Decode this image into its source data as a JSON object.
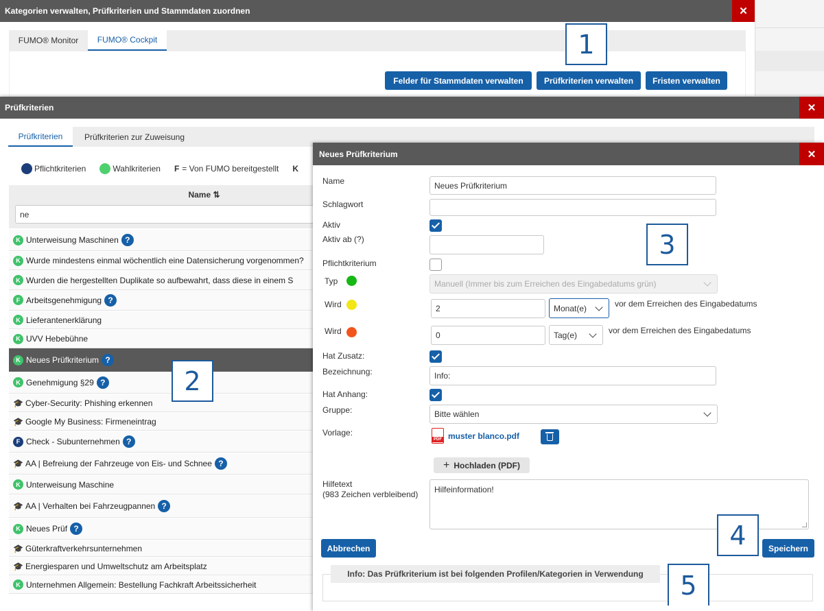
{
  "colors": {
    "primary": "#1660a8",
    "titlebar": "#595959",
    "close": "#c00000",
    "green": "#16b816",
    "yellow": "#f2e615",
    "orange": "#f2551b"
  },
  "win1": {
    "title": "Kategorien verwalten, Prüfkriterien und Stammdaten zuordnen",
    "tabs": [
      "FUMO® Monitor",
      "FUMO® Cockpit"
    ],
    "buttons": [
      "Felder für Stammdaten verwalten",
      "Prüfkriterien verwalten",
      "Fristen verwalten"
    ]
  },
  "win2": {
    "title": "Prüfkriterien",
    "tabs": [
      "Prüfkriterien",
      "Prüfkriterien zur Zuweisung"
    ],
    "legend": {
      "mandatory": "Pflichtkriterien",
      "optional": "Wahlkriterien",
      "f_key": "F",
      "f_text": "= Von FUMO bereitgestellt",
      "k_key": "K"
    },
    "column_header": "Name ⇅",
    "filter_value": "ne",
    "rows": [
      {
        "badge": "K",
        "icon": "k-badge",
        "label": "Unterweisung Maschinen",
        "help": true
      },
      {
        "badge": "K",
        "icon": "k-badge",
        "label": "Wurde mindestens einmal wöchentlich eine Datensicherung vorgenommen?",
        "help": false
      },
      {
        "badge": "K",
        "icon": "k-badge",
        "label": "Wurden die hergestellten Duplikate so aufbewahrt, dass diese in einem S",
        "help": false
      },
      {
        "badge": "F",
        "icon": "f-badge-green",
        "label": "Arbeitsgenehmigung",
        "help": true
      },
      {
        "badge": "K",
        "icon": "k-badge",
        "label": "Lieferantenerklärung",
        "help": false
      },
      {
        "badge": "K",
        "icon": "k-badge",
        "label": "UVV Hebebühne",
        "help": false
      },
      {
        "badge": "K",
        "icon": "k-badge",
        "label": "Neues Prüfkriterium",
        "help": true,
        "selected": true
      },
      {
        "badge": "K",
        "icon": "k-badge",
        "label": "Genehmigung §29",
        "help": true
      },
      {
        "badge": "",
        "icon": "graduation-cap-icon",
        "label": "Cyber-Security: Phishing erkennen",
        "help": false
      },
      {
        "badge": "",
        "icon": "graduation-cap-icon",
        "label": "Google My Business: Firmeneintrag",
        "help": false
      },
      {
        "badge": "F",
        "icon": "f-badge-blue",
        "label": "Check - Subunternehmen",
        "help": true
      },
      {
        "badge": "",
        "icon": "graduation-cap-icon",
        "label": "AA | Befreiung der Fahrzeuge von Eis- und Schnee",
        "help": true
      },
      {
        "badge": "K",
        "icon": "k-badge",
        "label": "Unterweisung Maschine",
        "help": false
      },
      {
        "badge": "",
        "icon": "graduation-cap-icon",
        "label": "AA | Verhalten bei Fahrzeugpannen",
        "help": true
      },
      {
        "badge": "K",
        "icon": "k-badge",
        "label": "Neues Prüf",
        "help": true
      },
      {
        "badge": "",
        "icon": "graduation-cap-icon",
        "label": "Güterkraftverkehrsunternehmen",
        "help": false
      },
      {
        "badge": "",
        "icon": "graduation-cap-icon",
        "label": "Energiesparen und Umweltschutz am Arbeitsplatz",
        "help": false
      },
      {
        "badge": "K",
        "icon": "k-badge",
        "label": "Unternehmen Allgemein: Bestellung Fachkraft Arbeitssicherheit",
        "help": false
      }
    ]
  },
  "win3": {
    "title": "Neues Prüfkriterium",
    "labels": {
      "name": "Name",
      "schlagwort": "Schlagwort",
      "aktiv": "Aktiv",
      "aktiv_ab": "Aktiv ab (?)",
      "pflicht": "Pflichtkriterium",
      "typ": "Typ",
      "wird1": "Wird",
      "wird2": "Wird",
      "zusatz": "Hat Zusatz:",
      "bezeichnung": "Bezeichnung:",
      "anhang": "Hat Anhang:",
      "gruppe": "Gruppe:",
      "vorlage": "Vorlage:",
      "hilfetext": "Hilfetext",
      "hilfetext_remaining": "(983 Zeichen verbleibend)"
    },
    "values": {
      "name": "Neues Prüfkriterium",
      "schlagwort": "",
      "aktiv_ab": "",
      "typ": "Manuell (Immer bis zum Erreichen des Eingabedatums grün)",
      "wird1_num": "2",
      "wird1_unit": "Monat(e)",
      "wird2_num": "0",
      "wird2_unit": "Tag(e)",
      "suffix": "vor dem Erreichen des Eingabedatums",
      "bezeichnung": "Info:",
      "gruppe": "Bitte wählen",
      "file": "muster blanco.pdf",
      "hilfetext": "Hilfeinformation!"
    },
    "checks": {
      "aktiv": true,
      "pflicht": false,
      "zusatz": true,
      "anhang": true
    },
    "buttons": {
      "upload": "Hochladen (PDF)",
      "cancel": "Abbrechen",
      "save": "Speichern"
    },
    "info_heading": "Info: Das Prüfkriterium ist bei folgenden Profilen/Kategorien in Verwendung"
  },
  "callouts": [
    "1",
    "2",
    "3",
    "4",
    "5"
  ]
}
